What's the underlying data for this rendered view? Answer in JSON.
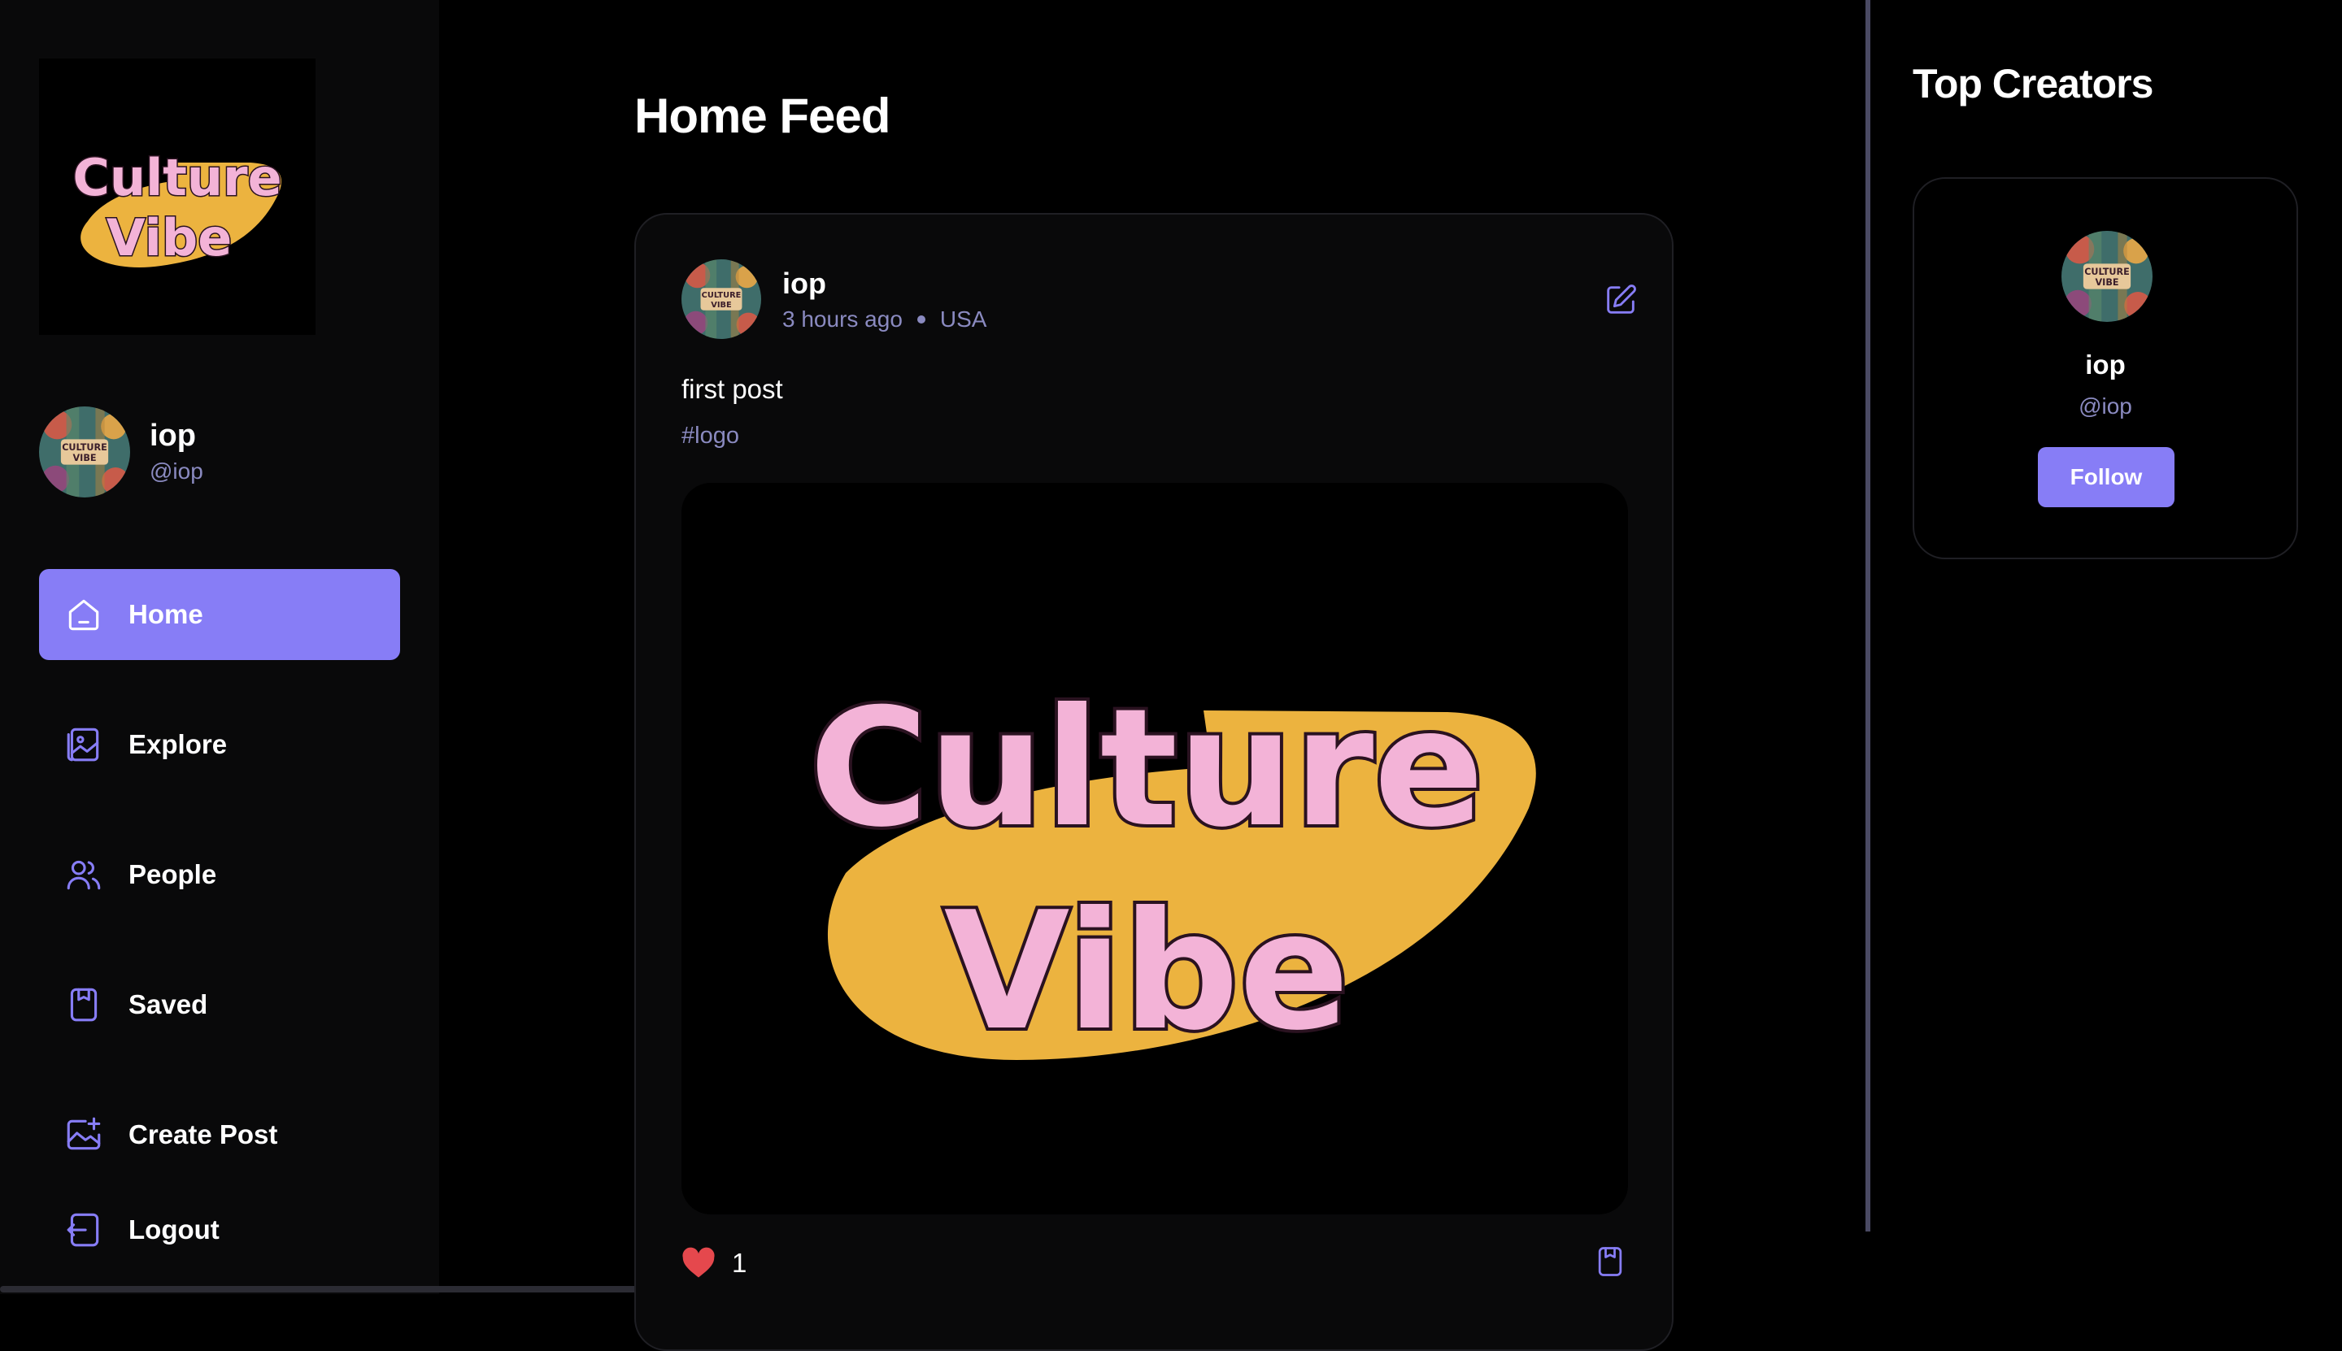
{
  "brand": {
    "logo_line1": "Culture",
    "logo_line2": "Vibe",
    "logo_text_color": "#f3b3d7",
    "logo_swoosh_color": "#ecb33f"
  },
  "colors": {
    "accent": "#877df6",
    "muted_text": "#8a8ac0",
    "background": "#000000",
    "sidebar_bg": "#09090a"
  },
  "user": {
    "name": "iop",
    "handle": "@iop",
    "avatar_label": "CULTURE VIBE"
  },
  "nav": {
    "items": [
      {
        "label": "Home",
        "icon": "home-icon",
        "active": true
      },
      {
        "label": "Explore",
        "icon": "gallery-icon",
        "active": false
      },
      {
        "label": "People",
        "icon": "people-icon",
        "active": false
      },
      {
        "label": "Saved",
        "icon": "bookmark-icon",
        "active": false
      },
      {
        "label": "Create Post",
        "icon": "image-plus-icon",
        "active": false
      }
    ],
    "logout_label": "Logout"
  },
  "feed": {
    "title": "Home Feed",
    "posts": [
      {
        "author": "iop",
        "time": "3 hours ago",
        "location": "USA",
        "caption": "first post",
        "tags": "#logo",
        "image_line1": "Culture",
        "image_line2": "Vibe",
        "likes": "1",
        "liked": true
      }
    ]
  },
  "top_creators": {
    "title": "Top Creators",
    "creators": [
      {
        "name": "iop",
        "handle": "@iop",
        "button_label": "Follow"
      }
    ]
  }
}
